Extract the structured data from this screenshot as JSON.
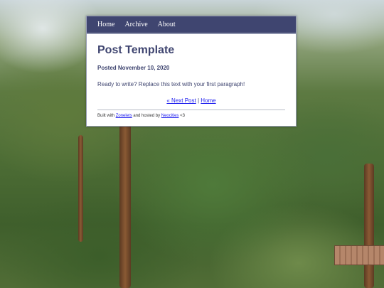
{
  "nav": {
    "items": [
      {
        "label": "Home"
      },
      {
        "label": "Archive"
      },
      {
        "label": "About"
      }
    ]
  },
  "post": {
    "title": "Post Template",
    "date": "Posted November 10, 2020",
    "body": "Ready to write? Replace this text with your first paragraph!"
  },
  "post_nav": {
    "next_label": "« Next Post",
    "separator": "|",
    "home_label": "Home"
  },
  "footer": {
    "prefix": "Built with",
    "zonelets_label": "Zonelets",
    "middle": "and hosted by",
    "neocities_label": "Neocities",
    "suffix": "<3"
  },
  "colors": {
    "nav_bg": "#3f4570",
    "text": "#3f4570",
    "link": "#1a1aee"
  }
}
